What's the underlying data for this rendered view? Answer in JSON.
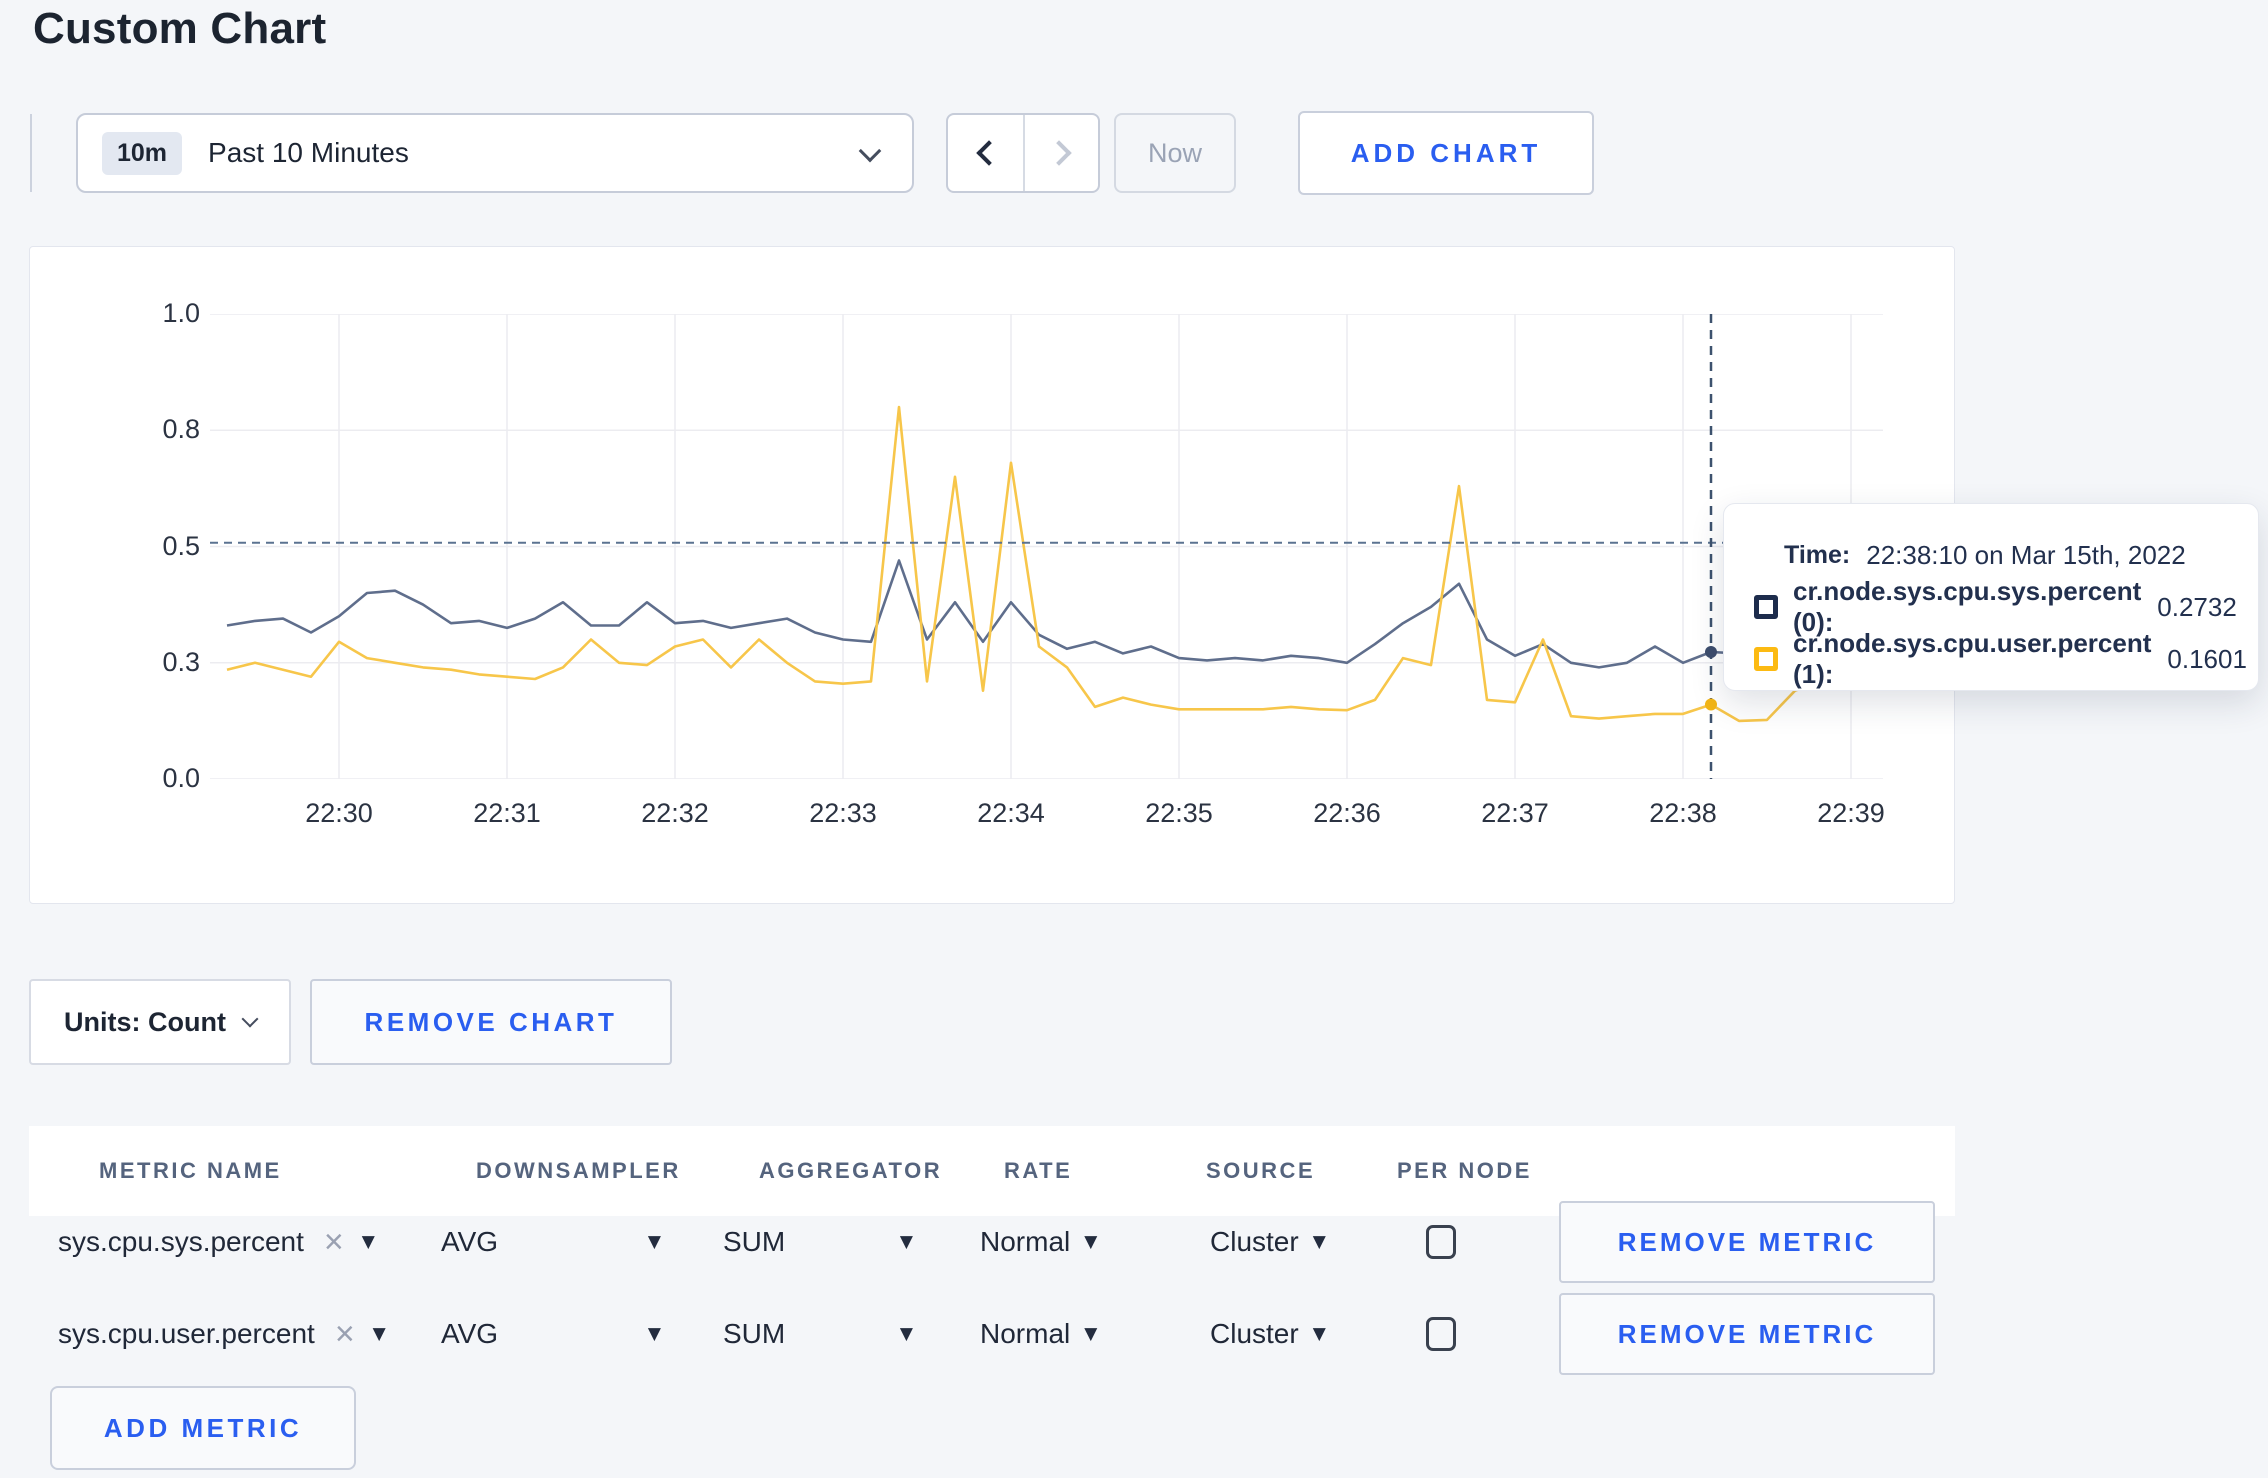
{
  "page": {
    "title": "Custom Chart"
  },
  "colors": {
    "accent_blue": "#2a5ef0",
    "navy_text": "#22304e",
    "sys_line": "#5f6e8c",
    "user_line": "#f7c64a",
    "sys_swatch": "#1d2c4c",
    "user_swatch": "#fcba12"
  },
  "toolbar": {
    "time_range": {
      "badge": "10m",
      "label": "Past 10 Minutes"
    },
    "now_label": "Now",
    "add_chart_label": "ADD CHART"
  },
  "tooltip": {
    "time_label": "Time:",
    "time_value": "22:38:10 on Mar 15th, 2022",
    "series": [
      {
        "label": "cr.node.sys.cpu.sys.percent (0):",
        "value": "0.2732",
        "swatch": "#1d2c4c"
      },
      {
        "label": "cr.node.sys.cpu.user.percent (1):",
        "value": "0.1601",
        "swatch": "#fcba12"
      }
    ]
  },
  "chart_controls": {
    "units_label": "Units: Count",
    "remove_chart_label": "REMOVE CHART"
  },
  "metrics_table": {
    "headers": [
      "METRIC NAME",
      "DOWNSAMPLER",
      "AGGREGATOR",
      "RATE",
      "SOURCE",
      "PER NODE"
    ],
    "rows": [
      {
        "name": "sys.cpu.sys.percent",
        "downsampler": "AVG",
        "aggregator": "SUM",
        "rate": "Normal",
        "source": "Cluster",
        "per_node_checked": false,
        "remove_label": "REMOVE METRIC"
      },
      {
        "name": "sys.cpu.user.percent",
        "downsampler": "AVG",
        "aggregator": "SUM",
        "rate": "Normal",
        "source": "Cluster",
        "per_node_checked": false,
        "remove_label": "REMOVE METRIC"
      }
    ],
    "add_metric_label": "ADD METRIC"
  },
  "chart_data": {
    "type": "line",
    "title": "",
    "xlabel": "",
    "ylabel": "",
    "grid": true,
    "legend_position": "tooltip",
    "ylim": [
      0.0,
      1.0
    ],
    "y_ticks": [
      {
        "label": "1.0",
        "v": 1.0
      },
      {
        "label": "0.8",
        "v": 0.75
      },
      {
        "label": "0.5",
        "v": 0.5
      },
      {
        "label": "0.3",
        "v": 0.25
      },
      {
        "label": "0.0",
        "v": 0.0
      }
    ],
    "x_ticks": [
      "22:30",
      "22:31",
      "22:32",
      "22:33",
      "22:34",
      "22:35",
      "22:36",
      "22:37",
      "22:38",
      "22:39"
    ],
    "start_time": "22:29:20",
    "interval_s": 10,
    "first_tick_offset_s": 40,
    "crosshair": {
      "time": "22:38:10",
      "index": 53,
      "hline_value": 0.508
    },
    "series": [
      {
        "name": "cr.node.sys.cpu.sys.percent",
        "color": "#5f6e8c",
        "dot_color": "#3d4d6d",
        "values": [
          0.33,
          0.34,
          0.345,
          0.315,
          0.35,
          0.4,
          0.405,
          0.375,
          0.335,
          0.34,
          0.325,
          0.345,
          0.38,
          0.33,
          0.33,
          0.38,
          0.335,
          0.34,
          0.325,
          0.335,
          0.345,
          0.315,
          0.3,
          0.295,
          0.47,
          0.3,
          0.38,
          0.295,
          0.38,
          0.31,
          0.28,
          0.295,
          0.27,
          0.285,
          0.26,
          0.255,
          0.26,
          0.255,
          0.265,
          0.26,
          0.25,
          0.29,
          0.335,
          0.37,
          0.42,
          0.3,
          0.265,
          0.29,
          0.25,
          0.24,
          0.25,
          0.285,
          0.25,
          0.2732,
          0.27,
          0.275,
          0.285,
          0.29,
          0.285,
          0.29
        ]
      },
      {
        "name": "cr.node.sys.cpu.user.percent",
        "color": "#f7c64a",
        "dot_color": "#f3b617",
        "values": [
          0.235,
          0.25,
          0.235,
          0.22,
          0.295,
          0.26,
          0.25,
          0.24,
          0.235,
          0.225,
          0.22,
          0.215,
          0.24,
          0.3,
          0.25,
          0.245,
          0.285,
          0.3,
          0.24,
          0.3,
          0.25,
          0.21,
          0.205,
          0.21,
          0.8,
          0.21,
          0.65,
          0.19,
          0.68,
          0.285,
          0.24,
          0.155,
          0.175,
          0.16,
          0.15,
          0.15,
          0.15,
          0.15,
          0.155,
          0.15,
          0.148,
          0.17,
          0.26,
          0.245,
          0.63,
          0.17,
          0.165,
          0.3,
          0.135,
          0.13,
          0.135,
          0.14,
          0.14,
          0.1601,
          0.125,
          0.127,
          0.19,
          0.21,
          0.27,
          0.24
        ]
      }
    ]
  }
}
